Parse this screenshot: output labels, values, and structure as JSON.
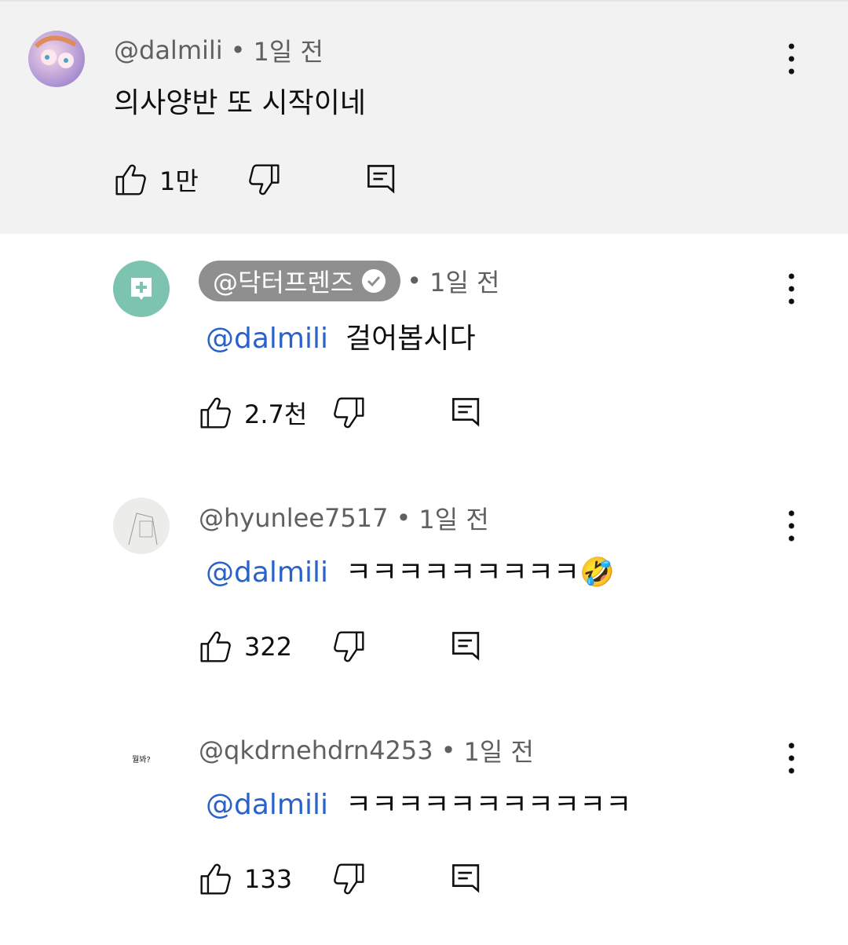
{
  "comments": [
    {
      "author": "@dalmili",
      "time": "1일 전",
      "text": "의사양반 또 시작이네",
      "likes": "1만",
      "avatar": "anime-avatar",
      "colors": {
        "bg": "#f2f2f2"
      }
    },
    {
      "author": "@닥터프렌즈",
      "verified": true,
      "time": "1일 전",
      "mention": "@dalmili",
      "text": "걸어봅시다",
      "likes": "2.7천",
      "avatar": "medical-chat-avatar",
      "colors": {
        "avatar": "#7dc4b0"
      }
    },
    {
      "author": "@hyunlee7517",
      "time": "1일 전",
      "mention": "@dalmili",
      "text": "ㅋㅋㅋㅋㅋㅋㅋㅋㅋ🤣",
      "likes": "322",
      "avatar": "sketch-avatar"
    },
    {
      "author": "@qkdrnehdrn4253",
      "time": "1일 전",
      "mention": "@dalmili",
      "text": "ㅋㅋㅋㅋㅋㅋㅋㅋㅋㅋㅋ",
      "likes": "133",
      "avatar": "text-avatar",
      "avatar_text": "뭘봐?"
    }
  ],
  "separator": "•",
  "accent": "#2a62c9"
}
